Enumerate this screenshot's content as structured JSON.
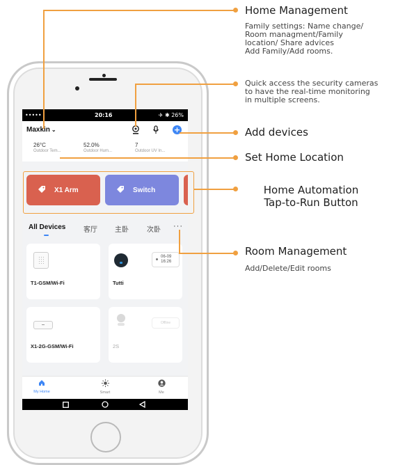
{
  "status_bar": {
    "signal": "•••••  ",
    "time": "20:16",
    "battery": "✈ ✱ 26%"
  },
  "header": {
    "home_name": "Maxkin",
    "chevron": "⌄",
    "add_symbol": "+"
  },
  "weather": [
    {
      "value": "26°C",
      "label": "Outdoor Tem..."
    },
    {
      "value": "52.0%",
      "label": "Outdoor Hum..."
    },
    {
      "value": "7",
      "label": "Outdoor UV In..."
    }
  ],
  "scenes": [
    {
      "label": "X1 Arm",
      "color": "#d9614f"
    },
    {
      "label": "Switch",
      "color": "#7d87de"
    }
  ],
  "tabs": [
    "All Devices",
    "客厅",
    "主卧",
    "次卧"
  ],
  "tabs_more": "···",
  "devices": [
    {
      "name": "T1-GSM/Wi-Fi"
    },
    {
      "name": "Tutti",
      "date": "06-09",
      "time": "16:26"
    },
    {
      "name": "X1-2G-GSM/Wi-Fi"
    },
    {
      "name": "2S",
      "offline_text": "Offline"
    }
  ],
  "tabbar": [
    {
      "label": "My Home"
    },
    {
      "label": "Smart"
    },
    {
      "label": "Me"
    }
  ],
  "annotations": {
    "home_management_title": "Home Management",
    "home_management_desc": [
      "Family settings: Name change/",
      "Room managment/Family",
      "location/ Share advices",
      "Add Family/Add rooms."
    ],
    "cameras_desc": [
      "Quick access the security cameras",
      "to have the real-time monitoring",
      "in multiple  screens."
    ],
    "add_devices": "Add devices",
    "set_home_location": "Set Home Location",
    "automation_line1": "Home Automation",
    "automation_line2": "Tap-to-Run Button",
    "room_management_title": "Room Management",
    "room_management_desc": "Add/Delete/Edit rooms"
  },
  "colors": {
    "accent": "#f0a040",
    "brand_blue": "#3d86f5"
  }
}
